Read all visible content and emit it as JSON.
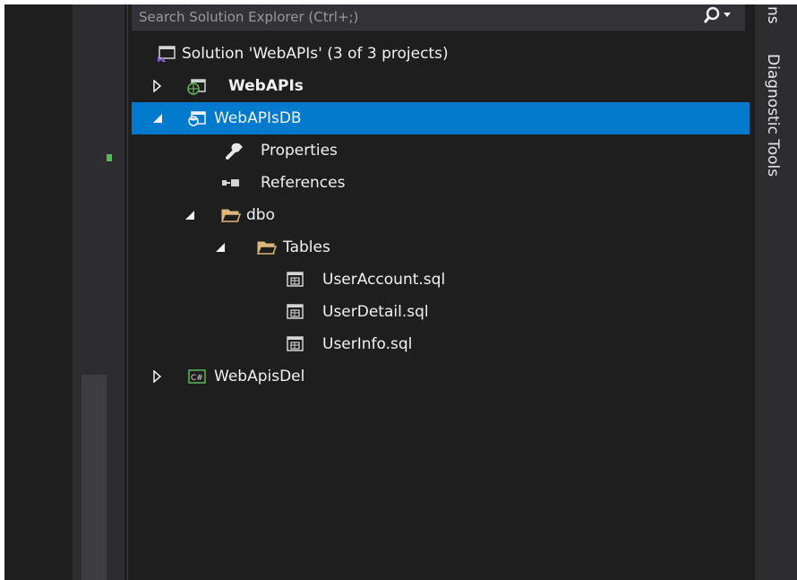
{
  "search": {
    "placeholder": "Search Solution Explorer (Ctrl+;)"
  },
  "side_tabs": {
    "diagnostic_tools": "Diagnostic Tools",
    "partial_top": "ns"
  },
  "tree": {
    "solution": "Solution 'WebAPIs' (3 of 3 projects)",
    "webapis": "WebAPIs",
    "webapisdb": "WebAPIsDB",
    "properties": "Properties",
    "references": "References",
    "dbo": "dbo",
    "tables": "Tables",
    "file1": "UserAccount.sql",
    "file2": "UserDetail.sql",
    "file3": "UserInfo.sql",
    "webapisdel": "WebApisDel"
  },
  "colors": {
    "selection": "#007acc",
    "background": "#1e1e1e",
    "text": "#f1f1f1"
  }
}
